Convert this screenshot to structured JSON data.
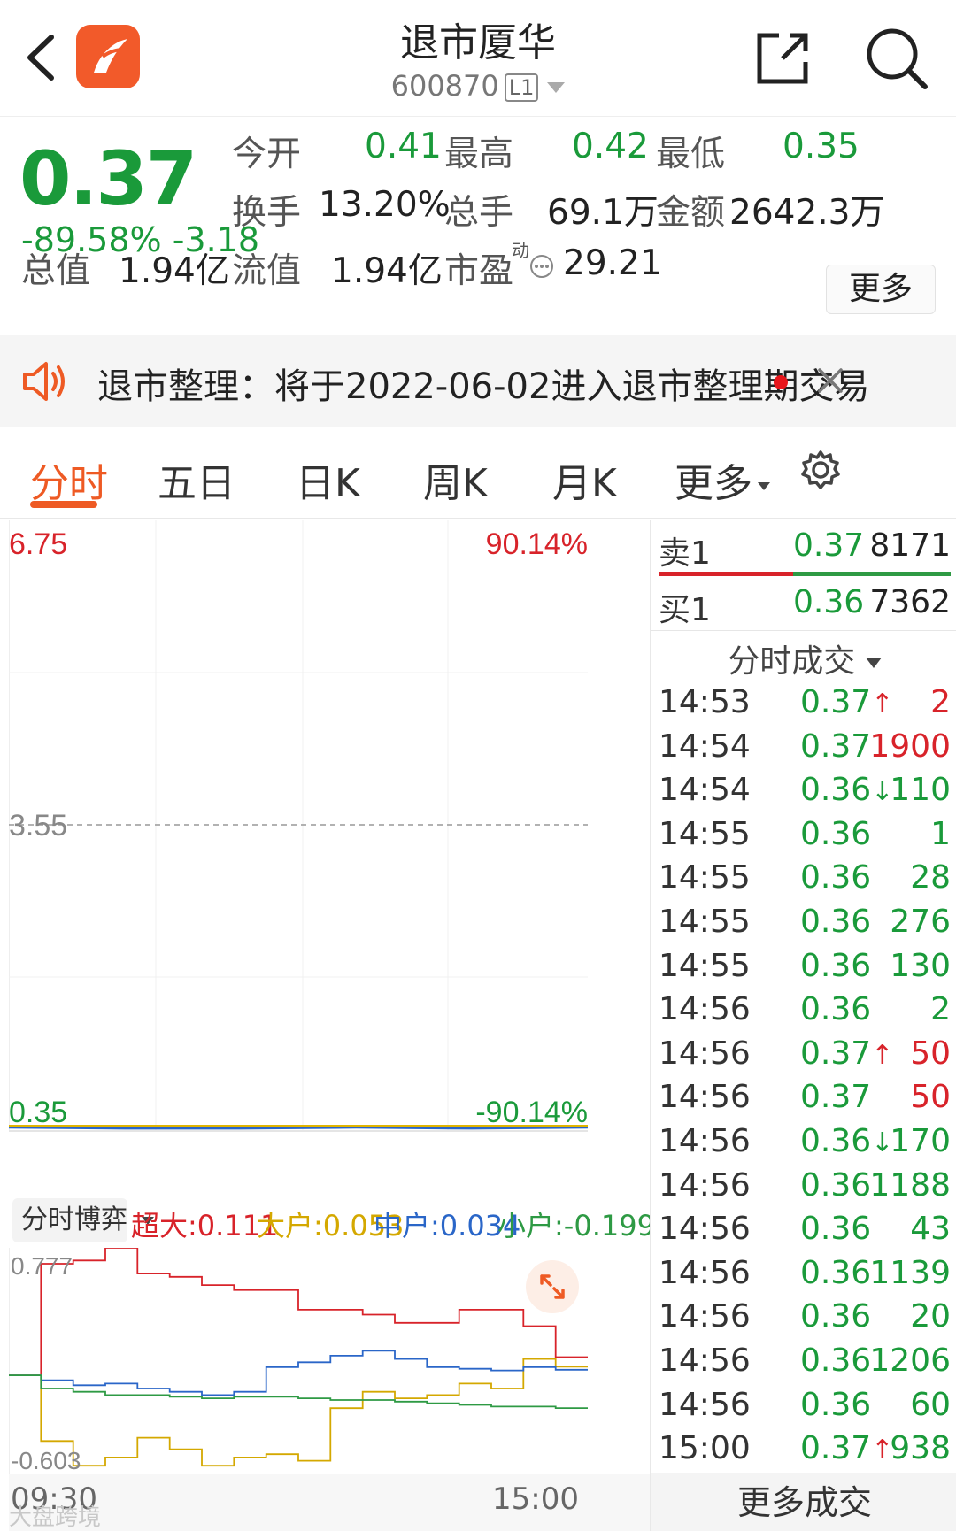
{
  "header": {
    "title": "退市厦华",
    "code": "600870",
    "level_badge": "L1"
  },
  "quote": {
    "price": "0.37",
    "change_pct": "-89.58%",
    "change_abs": "-3.18",
    "open_label": "今开",
    "open": "0.41",
    "high_label": "最高",
    "high": "0.42",
    "low_label": "最低",
    "low": "0.35",
    "turnover_label": "换手",
    "turnover": "13.20%",
    "volume_label": "总手",
    "volume": "69.1万",
    "amount_label": "金额",
    "amount": "2642.3万",
    "mktcap_label": "总值",
    "mktcap": "1.94亿",
    "float_label": "流值",
    "float": "1.94亿",
    "pe_label": "市盈",
    "pe_sup": "动",
    "pe": "29.21",
    "more_label": "更多"
  },
  "notice": {
    "text": "退市整理：将于2022-06-02进入退市整理期交易"
  },
  "tabs": [
    {
      "label": "分时",
      "active": true
    },
    {
      "label": "五日"
    },
    {
      "label": "日K"
    },
    {
      "label": "周K"
    },
    {
      "label": "月K"
    },
    {
      "label": "更多"
    }
  ],
  "chart_data": [
    {
      "type": "line",
      "title": "",
      "y_top_label": "6.75",
      "y_mid_label": "3.55",
      "y_bottom_label": "0.35",
      "pct_top_label": "90.14%",
      "pct_bottom_label": "-90.14%",
      "ylim": [
        0.35,
        6.75
      ],
      "series": [
        {
          "values": [
            0.37,
            0.36,
            0.36,
            0.37,
            0.36,
            0.37
          ]
        }
      ]
    },
    {
      "type": "line",
      "title": "分时博弈",
      "y_top_label": "0.777",
      "y_bottom_label": "-0.603",
      "ylim": [
        -0.603,
        0.777
      ],
      "x_start_label": "09:30",
      "x_end_label": "15:00",
      "series": [
        {
          "name": "超大",
          "value_label": "0.111",
          "color": "#d8232a",
          "values": [
            0.0,
            0.68,
            0.7,
            0.777,
            0.62,
            0.6,
            0.55,
            0.52,
            0.52,
            0.4,
            0.4,
            0.37,
            0.32,
            0.32,
            0.4,
            0.4,
            0.3,
            0.111
          ]
        },
        {
          "name": "大户",
          "value_label": "0.053",
          "color": "#d4a800",
          "values": [
            0.0,
            -0.4,
            -0.55,
            -0.5,
            -0.38,
            -0.45,
            -0.55,
            -0.5,
            -0.48,
            -0.52,
            -0.2,
            -0.1,
            -0.14,
            -0.12,
            -0.05,
            -0.08,
            0.1,
            0.053
          ]
        },
        {
          "name": "中户",
          "value_label": "0.034",
          "color": "#2a66c8",
          "values": [
            0.0,
            -0.03,
            -0.06,
            -0.05,
            -0.08,
            -0.1,
            -0.12,
            -0.1,
            0.05,
            0.08,
            0.12,
            0.15,
            0.1,
            0.05,
            0.04,
            0.03,
            0.05,
            0.034
          ]
        },
        {
          "name": "小户",
          "value_label": "-0.199",
          "color": "#2e9a44",
          "values": [
            0.0,
            -0.08,
            -0.1,
            -0.12,
            -0.12,
            -0.13,
            -0.14,
            -0.13,
            -0.13,
            -0.14,
            -0.15,
            -0.15,
            -0.16,
            -0.17,
            -0.18,
            -0.19,
            -0.19,
            -0.199
          ]
        }
      ]
    }
  ],
  "order_book": {
    "sell1_label": "卖1",
    "sell1_price": "0.37",
    "sell1_vol": "8171",
    "buy1_label": "买1",
    "buy1_price": "0.36",
    "buy1_vol": "7362"
  },
  "trades_header": "分时成交",
  "trades": [
    {
      "time": "14:53",
      "price": "0.37",
      "dir": "up",
      "vol": "2",
      "vol_color": "red"
    },
    {
      "time": "14:54",
      "price": "0.37",
      "dir": "",
      "vol": "1900",
      "vol_color": "red"
    },
    {
      "time": "14:54",
      "price": "0.36",
      "dir": "down",
      "vol": "110",
      "vol_color": "green"
    },
    {
      "time": "14:55",
      "price": "0.36",
      "dir": "",
      "vol": "1",
      "vol_color": "green"
    },
    {
      "time": "14:55",
      "price": "0.36",
      "dir": "",
      "vol": "28",
      "vol_color": "green"
    },
    {
      "time": "14:55",
      "price": "0.36",
      "dir": "",
      "vol": "276",
      "vol_color": "green"
    },
    {
      "time": "14:55",
      "price": "0.36",
      "dir": "",
      "vol": "130",
      "vol_color": "green"
    },
    {
      "time": "14:56",
      "price": "0.36",
      "dir": "",
      "vol": "2",
      "vol_color": "green"
    },
    {
      "time": "14:56",
      "price": "0.37",
      "dir": "up",
      "vol": "50",
      "vol_color": "red"
    },
    {
      "time": "14:56",
      "price": "0.37",
      "dir": "",
      "vol": "50",
      "vol_color": "red"
    },
    {
      "time": "14:56",
      "price": "0.36",
      "dir": "down",
      "vol": "170",
      "vol_color": "green"
    },
    {
      "time": "14:56",
      "price": "0.36",
      "dir": "",
      "vol": "1188",
      "vol_color": "green"
    },
    {
      "time": "14:56",
      "price": "0.36",
      "dir": "",
      "vol": "43",
      "vol_color": "green"
    },
    {
      "time": "14:56",
      "price": "0.36",
      "dir": "",
      "vol": "1139",
      "vol_color": "green"
    },
    {
      "time": "14:56",
      "price": "0.36",
      "dir": "",
      "vol": "20",
      "vol_color": "green"
    },
    {
      "time": "14:56",
      "price": "0.36",
      "dir": "",
      "vol": "1206",
      "vol_color": "green"
    },
    {
      "time": "14:56",
      "price": "0.36",
      "dir": "",
      "vol": "60",
      "vol_color": "green"
    },
    {
      "time": "15:00",
      "price": "0.37",
      "dir": "up",
      "vol": "938",
      "vol_color": "green"
    }
  ],
  "more_trades_label": "更多成交",
  "watermark": "大盘跨境",
  "icons": {
    "back": "chevron-left-icon",
    "logo": "app-logo-icon",
    "share": "share-icon",
    "search": "search-icon",
    "speaker": "speaker-icon",
    "close": "close-icon",
    "settings": "gear-icon",
    "expand": "expand-icon"
  },
  "colors": {
    "up": "#d8232a",
    "down": "#1a9a3a",
    "accent": "#ee5a24"
  }
}
